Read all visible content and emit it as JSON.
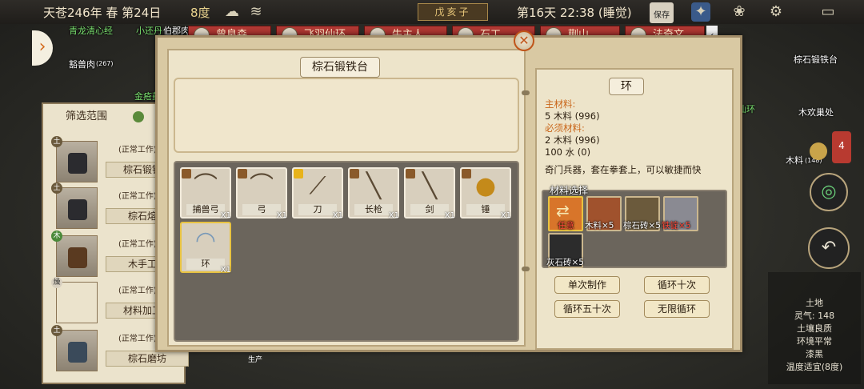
{
  "topbar": {
    "date": "天苍246年 春 第24日",
    "temperature": "8度",
    "ganzhi": "戊亥子",
    "time": "第16天 22:38 (睡觉)",
    "save_label": "保存"
  },
  "characters": [
    "曾良森",
    "飞羽仙环",
    "牛主人",
    "石工",
    "蒯山",
    "法奇文"
  ],
  "world_labels": {
    "a": "青龙清心经",
    "b": "小还丹",
    "c": "伯郡肉",
    "d": "豁兽肉",
    "e": "(267)",
    "f": "金疮药",
    "g": "棕石锻铁台",
    "h": "木欢巢处",
    "i": "飞羽仙环",
    "j": "木料",
    "k": "(148)",
    "l": "4"
  },
  "filter": {
    "title": "筛选范围",
    "buildings": [
      {
        "tag": "土",
        "status": "(正常工作)",
        "name": "棕石锻铁台"
      },
      {
        "tag": "土",
        "status": "(正常工作)",
        "name": "棕石熔炉"
      },
      {
        "tag": "木",
        "status": "(正常工作)",
        "name": "木手工桌"
      },
      {
        "tag": "燥",
        "status": "(正常工作)",
        "name": "材料加工点"
      },
      {
        "tag": "土",
        "status": "(正常工作)",
        "name": "棕石磨坊"
      }
    ]
  },
  "dialog": {
    "title": "棕石锻铁台",
    "items": [
      {
        "label": "捕兽弓",
        "qty": "X1",
        "icon": "bow-icon"
      },
      {
        "label": "弓",
        "qty": "X1",
        "icon": "bow-icon"
      },
      {
        "label": "刀",
        "qty": "X1",
        "icon": "saber-icon"
      },
      {
        "label": "长枪",
        "qty": "X1",
        "icon": "spear-icon"
      },
      {
        "label": "剑",
        "qty": "X1",
        "icon": "sword-icon"
      },
      {
        "label": "锤",
        "qty": "X1",
        "icon": "hammer-icon"
      },
      {
        "label": "环",
        "qty": "X1",
        "icon": "ring-icon"
      }
    ]
  },
  "detail": {
    "title": "环",
    "main_label": "主材料:",
    "main_value": "5 木料 (996)",
    "required_label": "必须材料:",
    "required_value1": "2 木料 (996)",
    "required_value2": "100 水 (0)",
    "description": "奇门兵器，套在拳套上，可以敏捷而快",
    "materials_title": "材料选择",
    "materials": [
      {
        "label": "任意",
        "red": true,
        "color": "#c9461a"
      },
      {
        "label": "木料×5",
        "red": false,
        "color": "#a0522d"
      },
      {
        "label": "棕石砖×5",
        "red": false,
        "color": "#6b5a3c"
      },
      {
        "label": "铁锭×5",
        "red": true,
        "color": "#8a8a92"
      },
      {
        "label": "灰石砖×5",
        "red": false,
        "color": "#2c2c2c"
      }
    ],
    "buttons": {
      "once": "单次制作",
      "ten": "循环十次",
      "fifty": "循环五十次",
      "infinite": "无限循环"
    }
  },
  "hud": {
    "terrain": "土地",
    "lingqi": "灵气: 148",
    "soil": "土壤良质",
    "env": "环境平常",
    "dark": "漆黑",
    "temp": "温度适宜(8度)",
    "production": "生产"
  }
}
